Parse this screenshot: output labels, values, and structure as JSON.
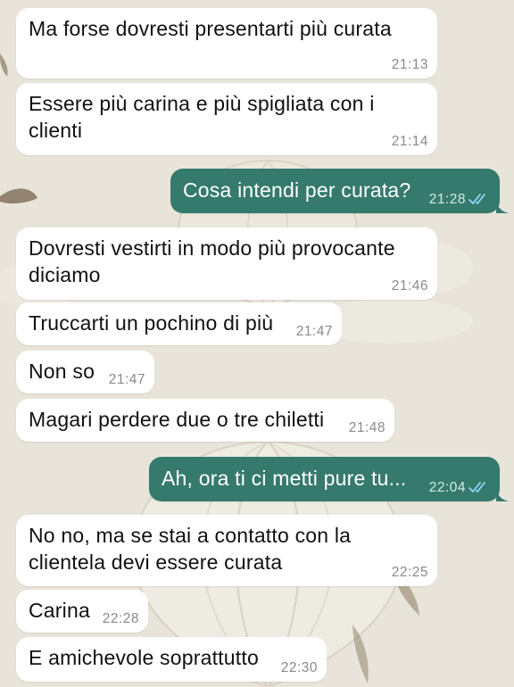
{
  "colors": {
    "incoming_bubble": "#ffffff",
    "outgoing_bubble": "#357a6c",
    "wallpaper": "#e8e4d9",
    "read_ticks": "#8fd8ff"
  },
  "messages": [
    {
      "direction": "in",
      "text": "Ma forse dovresti presentarti più curata",
      "time": "21:13"
    },
    {
      "direction": "in",
      "text": "Essere più carina e più spigliata con i\nclienti",
      "time": "21:14"
    },
    {
      "direction": "out",
      "text": "Cosa intendi per curata?",
      "time": "21:28",
      "status_icon": "double-check-read-icon"
    },
    {
      "direction": "in",
      "text": "Dovresti vestirti in modo più provocante\ndiciamo",
      "time": "21:46"
    },
    {
      "direction": "in",
      "text": "Truccarti un pochino di più",
      "time": "21:47"
    },
    {
      "direction": "in",
      "text": "Non so",
      "time": "21:47"
    },
    {
      "direction": "in",
      "text": "Magari perdere due o tre chiletti",
      "time": "21:48"
    },
    {
      "direction": "out",
      "text": "Ah, ora ti ci metti pure tu...",
      "time": "22:04",
      "status_icon": "double-check-read-icon"
    },
    {
      "direction": "in",
      "text": "No no, ma se stai a contatto con la\nclientela devi essere curata",
      "time": "22:25"
    },
    {
      "direction": "in",
      "text": "Carina",
      "time": "22:28"
    },
    {
      "direction": "in",
      "text": "E amichevole soprattutto",
      "time": "22:30"
    }
  ]
}
